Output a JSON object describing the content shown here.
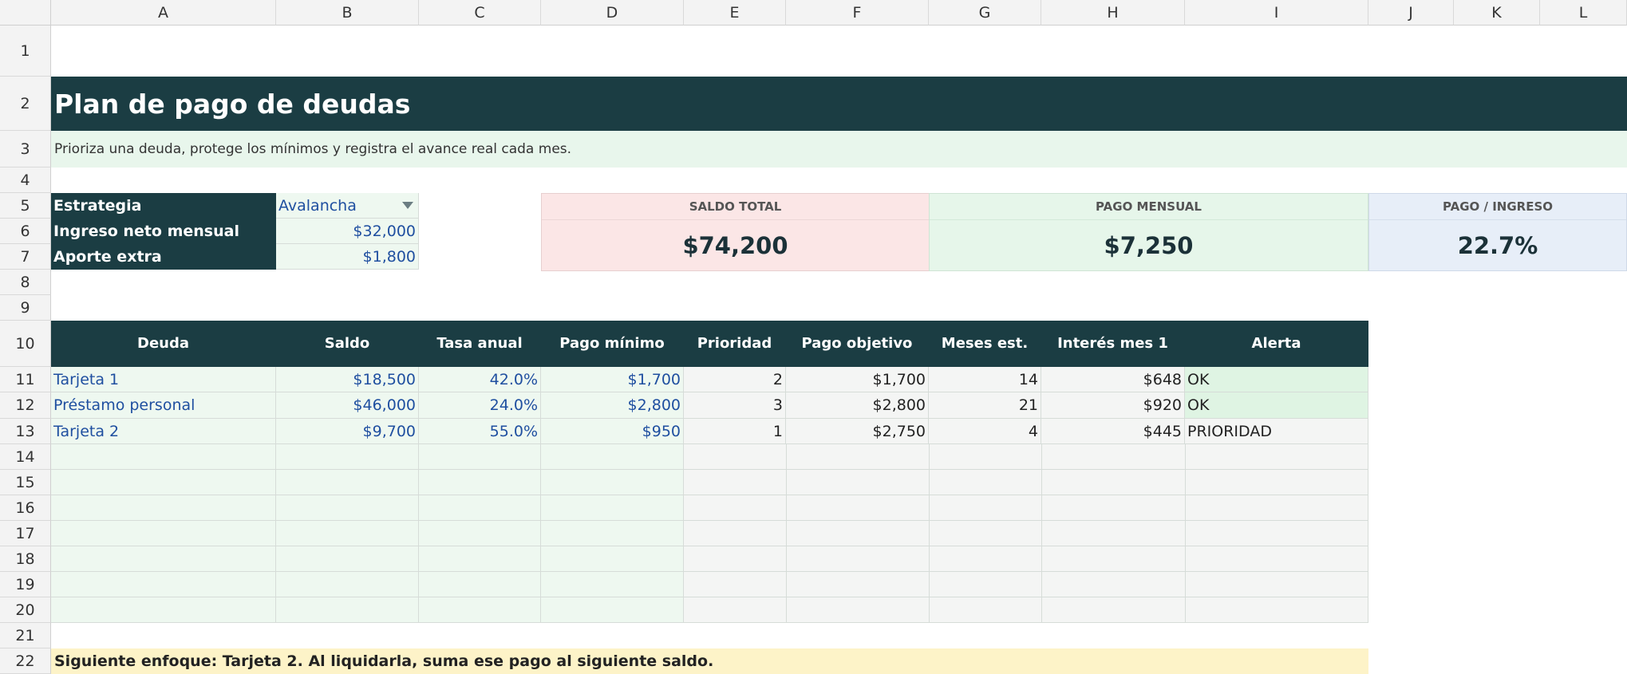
{
  "columns": [
    "A",
    "B",
    "C",
    "D",
    "E",
    "F",
    "G",
    "H",
    "I",
    "J",
    "K",
    "L"
  ],
  "rows": [
    "1",
    "2",
    "3",
    "4",
    "5",
    "6",
    "7",
    "8",
    "9",
    "10",
    "11",
    "12",
    "13",
    "14",
    "15",
    "16",
    "17",
    "18",
    "19",
    "20",
    "21",
    "22"
  ],
  "title": "Plan de pago de deudas",
  "subtitle": "Prioriza una deuda, protege los mínimos y registra el avance real cada mes.",
  "params": {
    "strategy_label": "Estrategia",
    "strategy_value": "Avalancha",
    "income_label": "Ingreso neto mensual",
    "income_value": "$32,000",
    "extra_label": "Aporte extra",
    "extra_value": "$1,800"
  },
  "kpis": [
    {
      "title": "SALDO TOTAL",
      "value": "$74,200",
      "color": "#fbe6e6"
    },
    {
      "title": "PAGO MENSUAL",
      "value": "$7,250",
      "color": "#e6f6ea"
    },
    {
      "title": "PAGO / INGRESO",
      "value": "22.7%",
      "color": "#e7eef8"
    }
  ],
  "table": {
    "headers": [
      "Deuda",
      "Saldo",
      "Tasa anual",
      "Pago mínimo",
      "Prioridad",
      "Pago objetivo",
      "Meses est.",
      "Interés mes 1",
      "Alerta"
    ],
    "rows": [
      [
        "Tarjeta 1",
        "$18,500",
        "42.0%",
        "$1,700",
        "2",
        "$1,700",
        "14",
        "$648",
        "OK"
      ],
      [
        "Préstamo personal",
        "$46,000",
        "24.0%",
        "$2,800",
        "3",
        "$2,800",
        "21",
        "$920",
        "OK"
      ],
      [
        "Tarjeta 2",
        "$9,700",
        "55.0%",
        "$950",
        "1",
        "$2,750",
        "4",
        "$445",
        "PRIORIDAD"
      ]
    ]
  },
  "footer_note": "Siguiente enfoque: Tarjeta 2. Al liquidarla, suma ese pago al siguiente saldo.",
  "colors": {
    "header_bg": "#1b3d43",
    "input_bg": "#eef8f0",
    "input_text": "#1f4fa0",
    "note_bg": "#fdf3c8",
    "subtitle_bg": "#e8f6ec"
  }
}
